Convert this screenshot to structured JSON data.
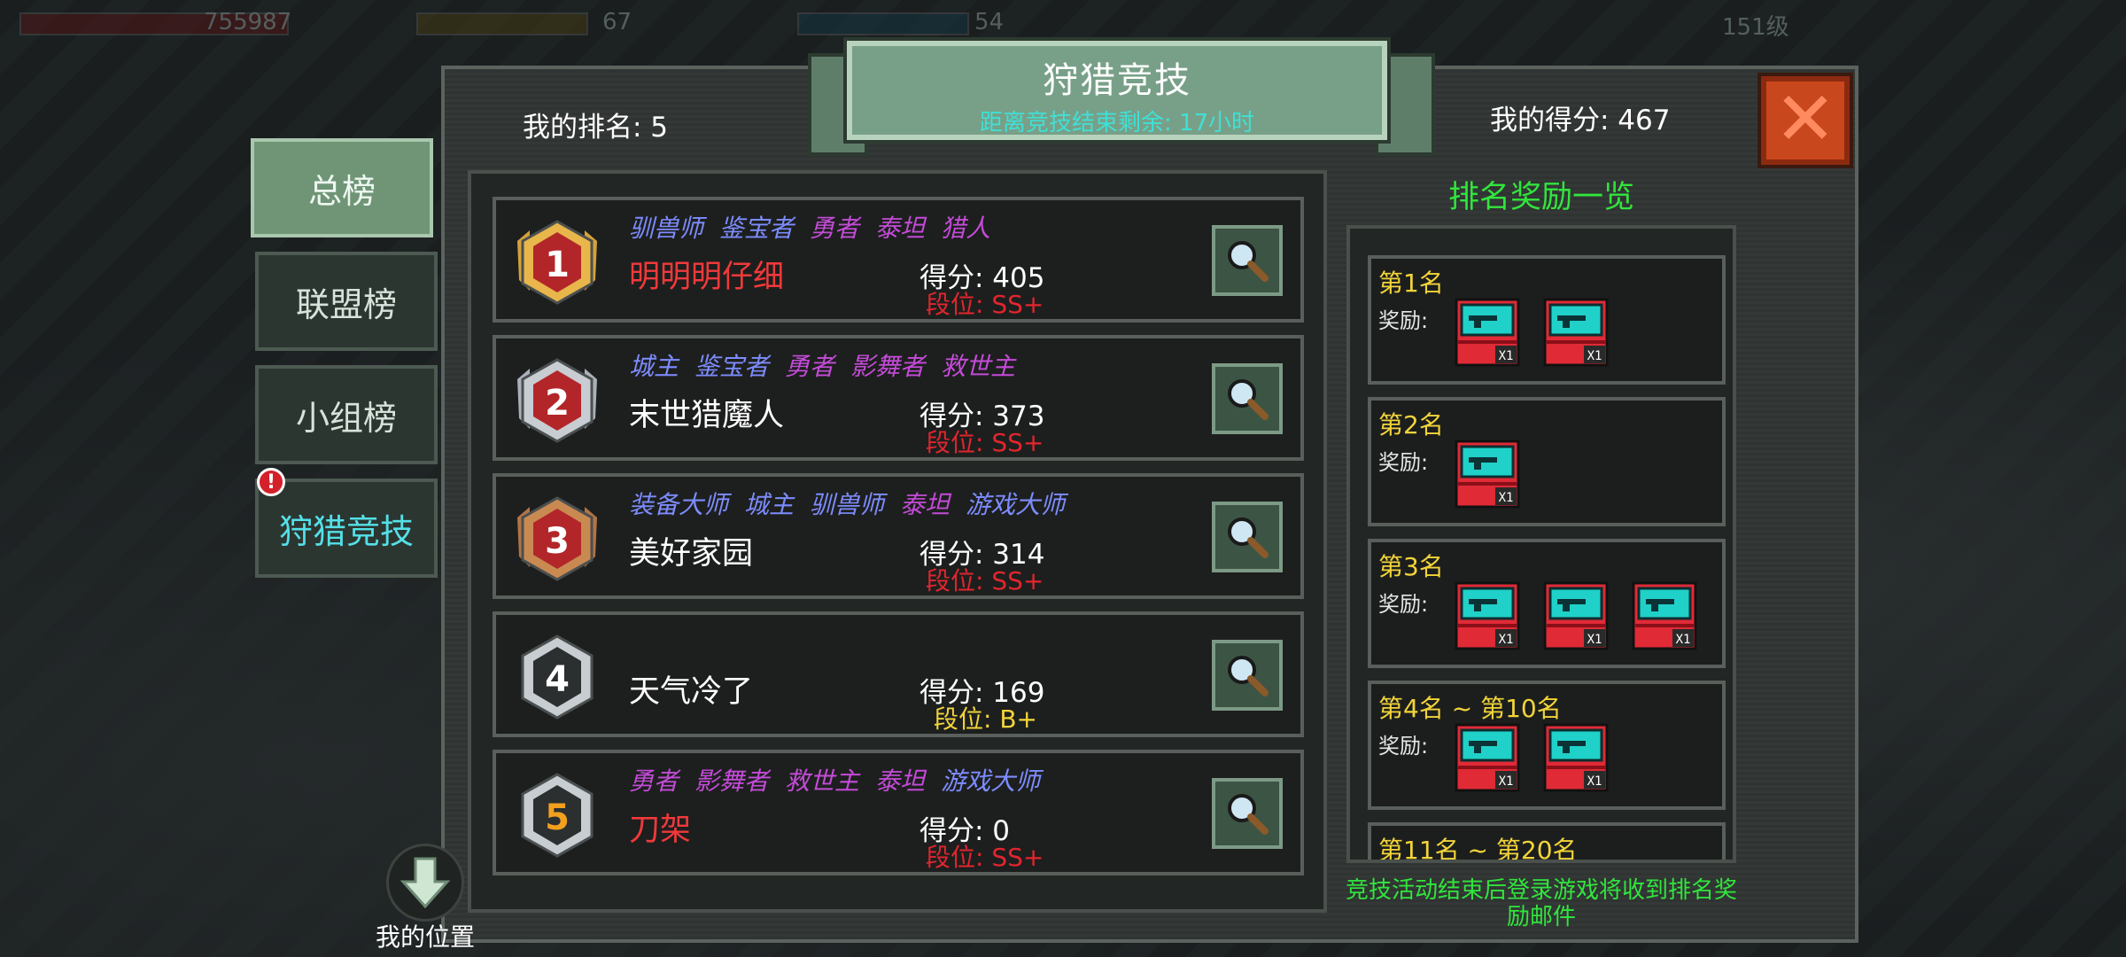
{
  "hud": {
    "hp": "755987",
    "energy": "67",
    "mana": "54",
    "level": "151级"
  },
  "title": {
    "main": "狩猎竞技",
    "countdown": "距离竞技结束剩余: 17小时"
  },
  "my_rank": "我的排名: 5",
  "my_score": "我的得分: 467",
  "tabs": [
    {
      "label": "总榜",
      "active": true
    },
    {
      "label": "联盟榜",
      "active": false
    },
    {
      "label": "小组榜",
      "active": false
    },
    {
      "label": "狩猎竞技",
      "active": false,
      "alert": "!"
    }
  ],
  "ranking": [
    {
      "rank": "1",
      "titles": [
        {
          "text": "驯兽师",
          "color": "#7d8cff"
        },
        {
          "text": "鉴宝者",
          "color": "#7d8cff"
        },
        {
          "text": "勇者",
          "color": "#c44bd8"
        },
        {
          "text": "泰坦",
          "color": "#c44bd8"
        },
        {
          "text": "猎人",
          "color": "#c44bd8"
        }
      ],
      "name": "明明明仔细",
      "name_color": "red",
      "score": "得分: 405",
      "tier": "段位: SS+",
      "tier_color": "red"
    },
    {
      "rank": "2",
      "titles": [
        {
          "text": "城主",
          "color": "#7d8cff"
        },
        {
          "text": "鉴宝者",
          "color": "#7d8cff"
        },
        {
          "text": "勇者",
          "color": "#c44bd8"
        },
        {
          "text": "影舞者",
          "color": "#c44bd8"
        },
        {
          "text": "救世主",
          "color": "#c44bd8"
        }
      ],
      "name": "末世猎魔人",
      "name_color": "white",
      "score": "得分: 373",
      "tier": "段位: SS+",
      "tier_color": "red"
    },
    {
      "rank": "3",
      "titles": [
        {
          "text": "装备大师",
          "color": "#7d8cff"
        },
        {
          "text": "城主",
          "color": "#7d8cff"
        },
        {
          "text": "驯兽师",
          "color": "#7d8cff"
        },
        {
          "text": "泰坦",
          "color": "#c44bd8"
        },
        {
          "text": "游戏大师",
          "color": "#7d8cff"
        }
      ],
      "name": "美好家园",
      "name_color": "white",
      "score": "得分: 314",
      "tier": "段位: SS+",
      "tier_color": "red"
    },
    {
      "rank": "4",
      "titles": [],
      "name": "天气冷了",
      "name_color": "white",
      "score": "得分: 169",
      "tier": "段位: B+",
      "tier_color": "gold"
    },
    {
      "rank": "5",
      "titles": [
        {
          "text": "勇者",
          "color": "#c44bd8"
        },
        {
          "text": "影舞者",
          "color": "#c44bd8"
        },
        {
          "text": "救世主",
          "color": "#c44bd8"
        },
        {
          "text": "泰坦",
          "color": "#c44bd8"
        },
        {
          "text": "游戏大师",
          "color": "#7d8cff"
        }
      ],
      "name": "刀架",
      "name_color": "red",
      "score": "得分: 0",
      "tier": "段位: SS+",
      "tier_color": "red"
    }
  ],
  "rewards": {
    "title": "排名奖励一览",
    "reward_label": "奖励:",
    "item_qty": "X1",
    "tiers": [
      {
        "rank": "第1名",
        "items": 2
      },
      {
        "rank": "第2名",
        "items": 1
      },
      {
        "rank": "第3名",
        "items": 3
      },
      {
        "rank": "第4名 ~ 第10名",
        "items": 2
      },
      {
        "rank": "第11名 ~ 第20名",
        "items": 0
      }
    ],
    "note": "竞技活动结束后登录游戏将收到排名奖励邮件"
  },
  "my_position": "我的位置",
  "colors": {
    "accent_green": "#31e53d",
    "tab_active": "#6f9576",
    "close": "#c9471c",
    "tier_red": "#e3252e",
    "tier_gold": "#f2d43a"
  }
}
